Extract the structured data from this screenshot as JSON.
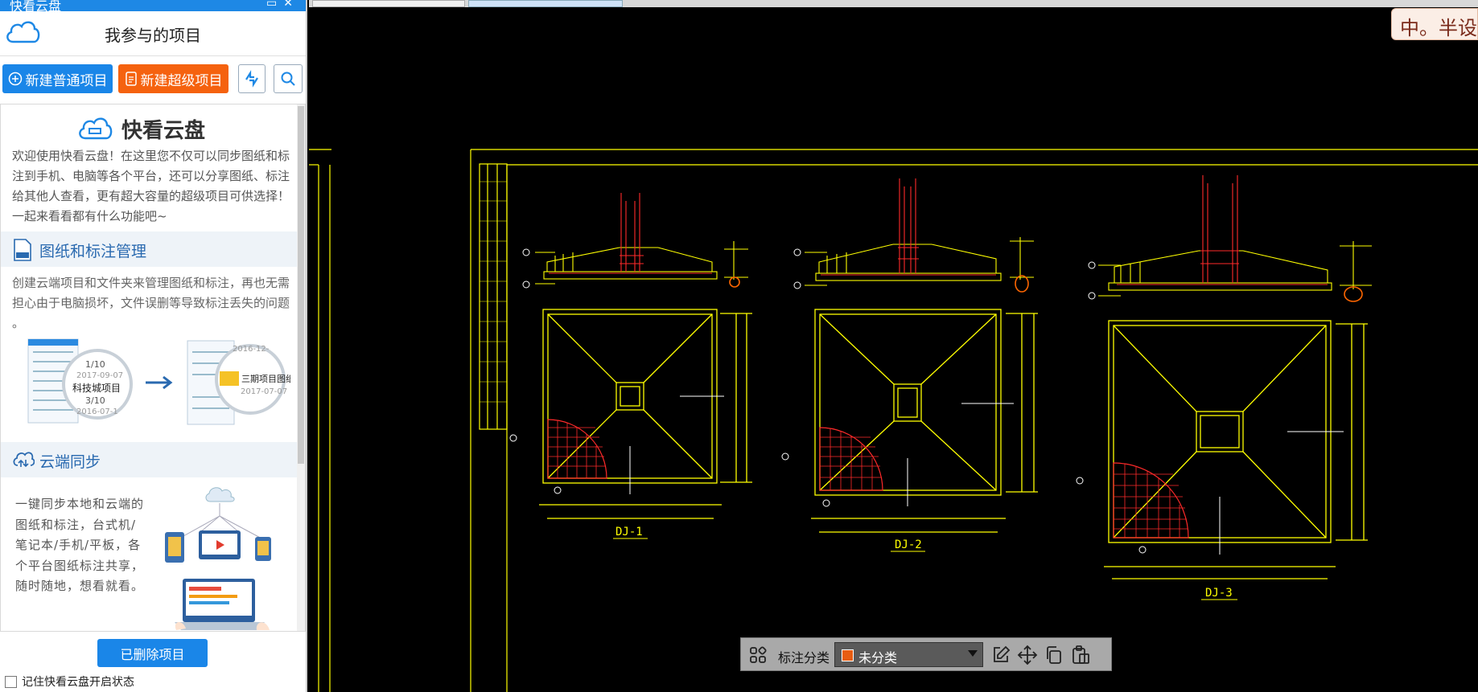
{
  "panel": {
    "window_title": "快看云盘",
    "heading": "我参与的项目",
    "btn_new_normal": "新建普通项目",
    "btn_new_super": "新建超级项目"
  },
  "promo": {
    "title": "快看云盘",
    "intro": "欢迎使用快看云盘！在这里您不仅可以同步图纸和标注到手机、电脑等各个平台，还可以分享图纸、标注给其他人查看，更有超大容量的超级项目可供选择！一起来看看都有什么功能吧~",
    "section1": {
      "title": "图纸和标注管理",
      "text": "创建云端项目和文件夹来管理图纸和标注，再也无需担心由于电脑损坏，文件误删等导致标注丢失的问题 。",
      "illus": {
        "card_left_items": [
          "1/10",
          "2017-09-07",
          "科技城项目",
          "3/10",
          "2016-07-1"
        ],
        "card_right_items": [
          "2016-12-",
          "三期项目图纸",
          "2017-07-07"
        ]
      }
    },
    "section2": {
      "title": "云端同步",
      "text": "一键同步本地和云端的图纸和标注，台式机/笔记本/手机/平板，各个平台图纸标注共享，随时随地，想看就看。"
    }
  },
  "btn_deleted": "已删除项目",
  "remember_label": "记住快看云盘开启状态",
  "ime_indicator": "中。半设",
  "annotation_bar": {
    "label": "标注分类",
    "selected": "未分类",
    "selected_color": "#e85d12"
  },
  "drawing": {
    "labels": [
      "DJ-1",
      "DJ-2",
      "DJ-3"
    ]
  }
}
